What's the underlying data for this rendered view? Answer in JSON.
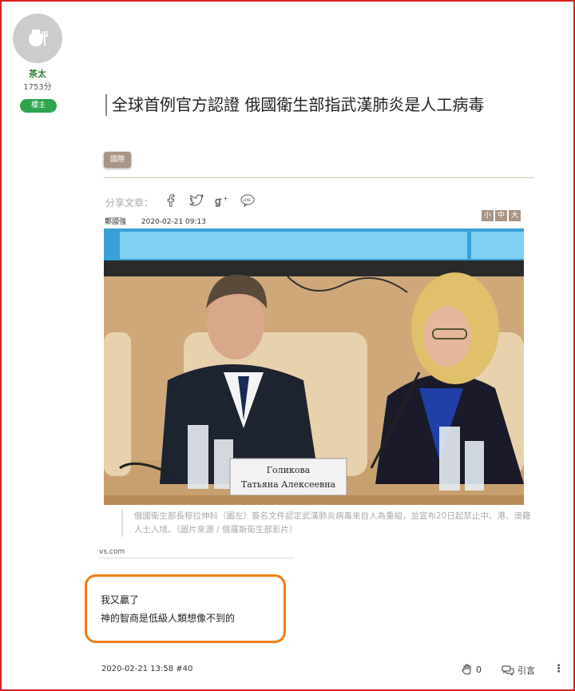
{
  "user": {
    "name": "茶太",
    "points": "1753分",
    "role_badge": "樓主"
  },
  "article": {
    "title": "全球首例官方認證 俄國衛生部指武漢肺炎是人工病毒",
    "category": "國際",
    "share_label": "分享文章：",
    "share_icons": [
      "facebook-icon",
      "twitter-icon",
      "google-plus-icon",
      "line-icon"
    ],
    "author": "鄭國強",
    "published": "2020-02-21 09:13",
    "font_sizes": [
      "小",
      "中",
      "大"
    ],
    "photo": {
      "nameplate_line1": "Голикова",
      "nameplate_line2": "Татьяна Алексеевна"
    },
    "caption": "俄國衛生部長穆拉伸科（圖左）簽名文件認定武漢肺炎病毒來自人為重組，並宣布20日起禁止中、港、澳籍人士入境。（圖片來源 / 俄羅斯衛生部影片）",
    "site_fragment": "vs.com"
  },
  "reply": {
    "line1": "我又贏了",
    "line2": "神的智商是低級人類想像不到的"
  },
  "footer": {
    "timestamp": "2020-02-21 13:58 #40",
    "like_count": "0",
    "quote_label": "引言",
    "more_icon": "⋮"
  },
  "colors": {
    "border": "#d42020",
    "highlight": "#f07d12",
    "badge": "#2ea44f",
    "username": "#2e7d32",
    "tag": "#a89586"
  }
}
